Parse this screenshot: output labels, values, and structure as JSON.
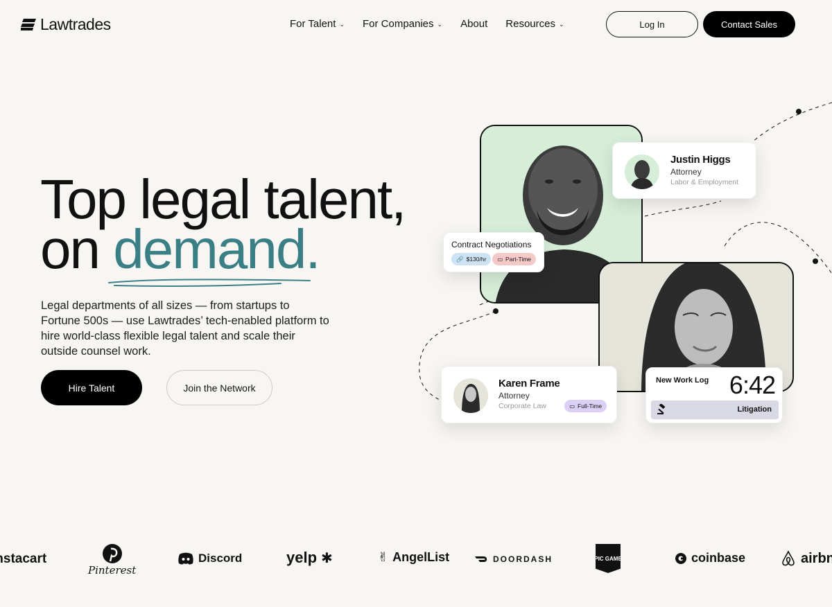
{
  "nav": {
    "brand": "Lawtrades",
    "items": [
      {
        "label": "For Talent",
        "has_menu": true
      },
      {
        "label": "For Companies",
        "has_menu": true
      },
      {
        "label": "About",
        "has_menu": false
      },
      {
        "label": "Resources",
        "has_menu": true
      }
    ],
    "login_label": "Log In",
    "contact_label": "Contact Sales"
  },
  "hero": {
    "title_line1": "Top legal talent,",
    "title_on": "on ",
    "title_accent": "demand.",
    "accent_color": "#3b7f86",
    "description": "Legal departments of all sizes — from startups to Fortune 500s — use Lawtrades’ tech-enabled platform to hire world-class flexible legal talent and scale their outside counsel work.",
    "hire_label": "Hire Talent",
    "join_label": "Join the Network"
  },
  "cards": {
    "justin": {
      "name": "Justin Higgs",
      "role": "Attorney",
      "specialty": "Labor & Employment"
    },
    "contract": {
      "title": "Contract Negotiations",
      "rate": "$130/hr",
      "type": "Part-Time"
    },
    "karen": {
      "name": "Karen Frame",
      "role": "Attorney",
      "specialty": "Corporate Law",
      "type": "Full-Time"
    },
    "worklog": {
      "title": "New Work Log",
      "time": "6:42",
      "category": "Litigation"
    }
  },
  "logos": [
    {
      "name": "instacart",
      "label": "instacart"
    },
    {
      "name": "pinterest",
      "label": "Pinterest"
    },
    {
      "name": "discord",
      "label": "Discord"
    },
    {
      "name": "yelp",
      "label": "yelp"
    },
    {
      "name": "angellist",
      "label": "AngelList"
    },
    {
      "name": "doordash",
      "label": "DOORDASH"
    },
    {
      "name": "epic-games",
      "label": "EPIC GAMES"
    },
    {
      "name": "coinbase",
      "label": "coinbase"
    },
    {
      "name": "airbnb",
      "label": "airbnb"
    }
  ]
}
